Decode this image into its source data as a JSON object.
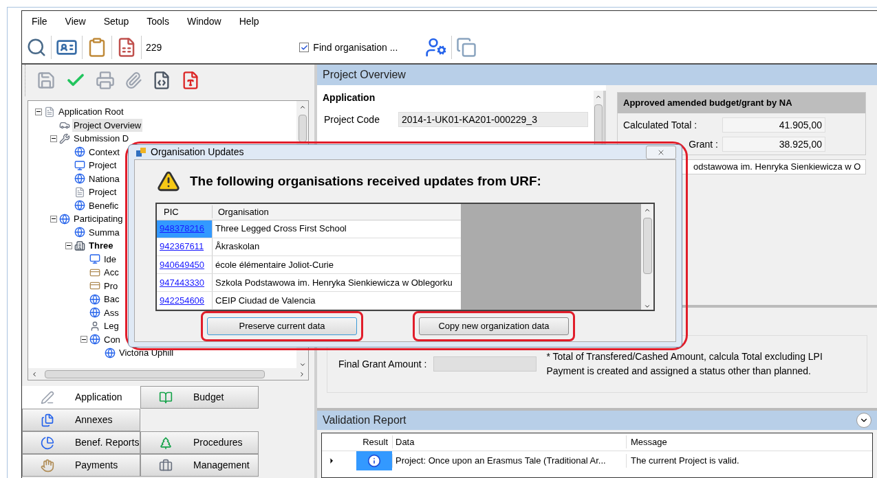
{
  "menu": [
    "File",
    "View",
    "Setup",
    "Tools",
    "Window",
    "Help"
  ],
  "toolbar": {
    "counter": "229",
    "find_checkbox": {
      "label": "Find organisation ...",
      "checked": true
    }
  },
  "tree": [
    {
      "label": "Application Root",
      "selected": false,
      "bold": false,
      "expanded": true,
      "children": [
        {
          "label": "Project Overview",
          "selected": true,
          "bold": false
        },
        {
          "label": "Submission D",
          "selected": false,
          "bold": false,
          "expanded": true,
          "children": [
            {
              "label": "Context",
              "selected": false,
              "bold": false
            },
            {
              "label": "Project",
              "selected": false,
              "bold": false
            },
            {
              "label": "Nationa",
              "selected": false,
              "bold": false
            },
            {
              "label": "Project",
              "selected": false,
              "bold": false
            },
            {
              "label": "Benefic",
              "selected": false,
              "bold": false
            }
          ]
        },
        {
          "label": "Participating",
          "selected": false,
          "bold": false,
          "expanded": true,
          "children": [
            {
              "label": "Summa",
              "selected": false,
              "bold": false
            },
            {
              "label": "Three",
              "selected": false,
              "bold": true,
              "expanded": true,
              "children": [
                {
                  "label": "Ide",
                  "selected": false,
                  "bold": false
                },
                {
                  "label": "Acc",
                  "selected": false,
                  "bold": false
                },
                {
                  "label": "Pro",
                  "selected": false,
                  "bold": false
                },
                {
                  "label": "Bac",
                  "selected": false,
                  "bold": false
                },
                {
                  "label": "Ass",
                  "selected": false,
                  "bold": false
                },
                {
                  "label": "Leg",
                  "selected": false,
                  "bold": false
                },
                {
                  "label": "Con",
                  "selected": false,
                  "bold": false,
                  "expanded": true,
                  "children": [
                    {
                      "label": "Victoria Uphill",
                      "selected": false,
                      "bold": false
                    }
                  ]
                }
              ]
            }
          ]
        }
      ]
    }
  ],
  "tabs": [
    [
      {
        "label": "Application",
        "selected": true
      },
      {
        "label": "Budget",
        "selected": false
      }
    ],
    [
      {
        "label": "Annexes",
        "selected": false
      }
    ],
    [
      {
        "label": "Benef. Reports",
        "selected": false
      },
      {
        "label": "Procedures",
        "selected": false
      }
    ],
    [
      {
        "label": "Payments",
        "selected": false
      },
      {
        "label": "Management",
        "selected": false
      }
    ]
  ],
  "overview": {
    "title": "Project Overview",
    "section": "Application",
    "fields": [
      {
        "label": "Project Code",
        "value": "2014-1-UK01-KA201-000229_3"
      }
    ],
    "budget": {
      "title": "Approved amended budget/grant by NA",
      "rows": [
        {
          "label": "Calculated Total :",
          "value": "41.905,00"
        },
        {
          "label": "Grant :",
          "value": "38.925,00"
        }
      ],
      "organisation": "odstawowa im. Henryka Sienkiewicza w O"
    },
    "final": {
      "label": "Final Grant Amount :",
      "note": "* Total of Transfered/Cashed Amount, calcula",
      "note_2": "Payment is created and assigned a status other than planned.",
      "total_note": "Total excluding LPI"
    }
  },
  "validation": {
    "title": "Validation Report",
    "columns": [
      "Result",
      "Data",
      "Message"
    ],
    "rows": [
      {
        "kind": "info",
        "selected": true,
        "data": "Project: Once upon an Erasmus Tale (Traditional Ar...",
        "message": "The current Project is valid."
      }
    ]
  },
  "dialog": {
    "title": "Organisation Updates",
    "heading": "The following organisations received updates from URF:",
    "columns": [
      "PIC",
      "Organisation"
    ],
    "rows": [
      {
        "pic": "948378216",
        "organisation": "Three Legged Cross First School",
        "selected": true
      },
      {
        "pic": "942367611",
        "organisation": "Åkraskolan",
        "selected": false
      },
      {
        "pic": "940649450",
        "organisation": "école élémentaire Joliot-Curie",
        "selected": false
      },
      {
        "pic": "947443330",
        "organisation": "Szkola Podstawowa im. Henryka Sienkiewicza w Oblegorku",
        "selected": false
      },
      {
        "pic": "942254606",
        "organisation": "CEIP Ciudad de Valencia",
        "selected": false
      }
    ],
    "buttons": [
      {
        "label": "Preserve current data",
        "focused": true
      },
      {
        "label": "Copy new organization data",
        "focused": false
      }
    ]
  }
}
